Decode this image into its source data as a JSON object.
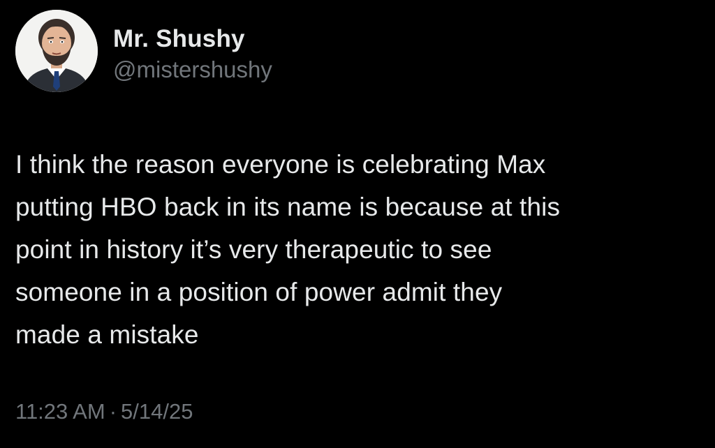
{
  "author": {
    "display_name": "Mr. Shushy",
    "handle": "@mistershushy",
    "avatar_icon": "cartoon-bearded-man-avatar"
  },
  "post": {
    "lines": [
      "I think the reason everyone is celebrating Max",
      "putting HBO back in its name is because at this",
      "point in history it’s very therapeutic to see",
      "someone in a position of power admit they",
      "made a mistake"
    ]
  },
  "meta": {
    "time": "11:23 AM",
    "separator": "·",
    "date": "5/14/25"
  },
  "colors": {
    "background": "#000000",
    "primary_text": "#e7e9ea",
    "secondary_text": "#71767b"
  }
}
